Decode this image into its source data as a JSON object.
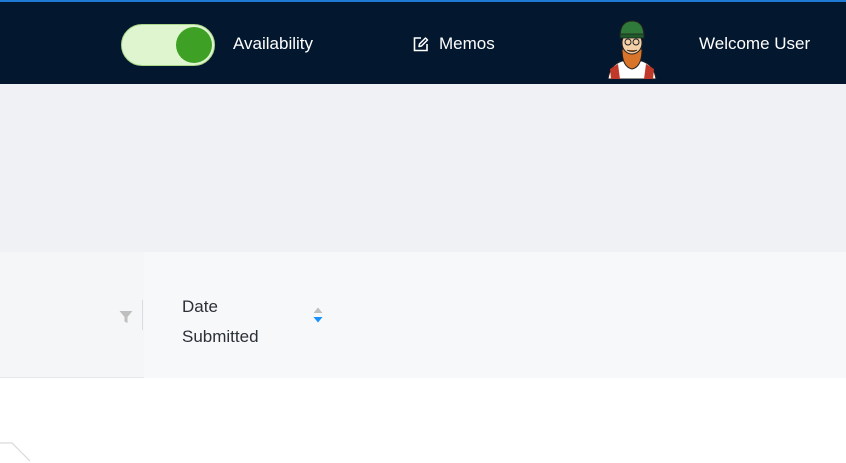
{
  "header": {
    "availability": {
      "label": "Availability",
      "enabled": true,
      "colors": {
        "track": "#dff5cf",
        "knob": "#3fa026"
      }
    },
    "memos": {
      "label": "Memos",
      "icon": "edit-icon"
    },
    "user": {
      "welcome": "Welcome User",
      "avatar": "bearded-man-avatar"
    },
    "colors": {
      "background": "#03182e",
      "accent_line": "#1f7ad6"
    }
  },
  "table": {
    "columns": [
      {
        "label": "",
        "icon": "filter-icon"
      },
      {
        "label": "Date Submitted",
        "icon": "sort-icon",
        "sort_active": "descending"
      }
    ],
    "colors": {
      "sort_active": "#1890ff",
      "sort_inactive": "#bfbfbf"
    }
  }
}
